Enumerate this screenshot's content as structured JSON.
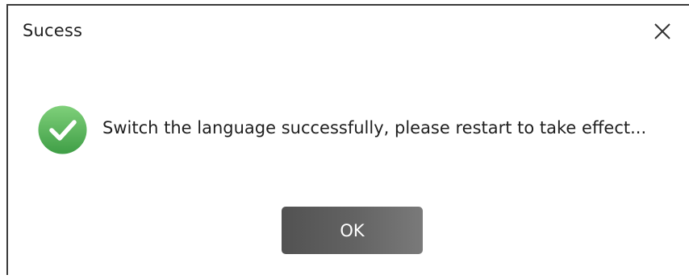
{
  "dialog": {
    "title": "Sucess",
    "close_icon": "close-icon",
    "status_icon": "success-check-icon",
    "message": "Switch the language successfully, please restart to take effect...",
    "ok_label": "OK"
  },
  "colors": {
    "success_green": "#5cb85c",
    "button_dark": "#525252",
    "button_light": "#7a7a7a",
    "text": "#222222"
  }
}
